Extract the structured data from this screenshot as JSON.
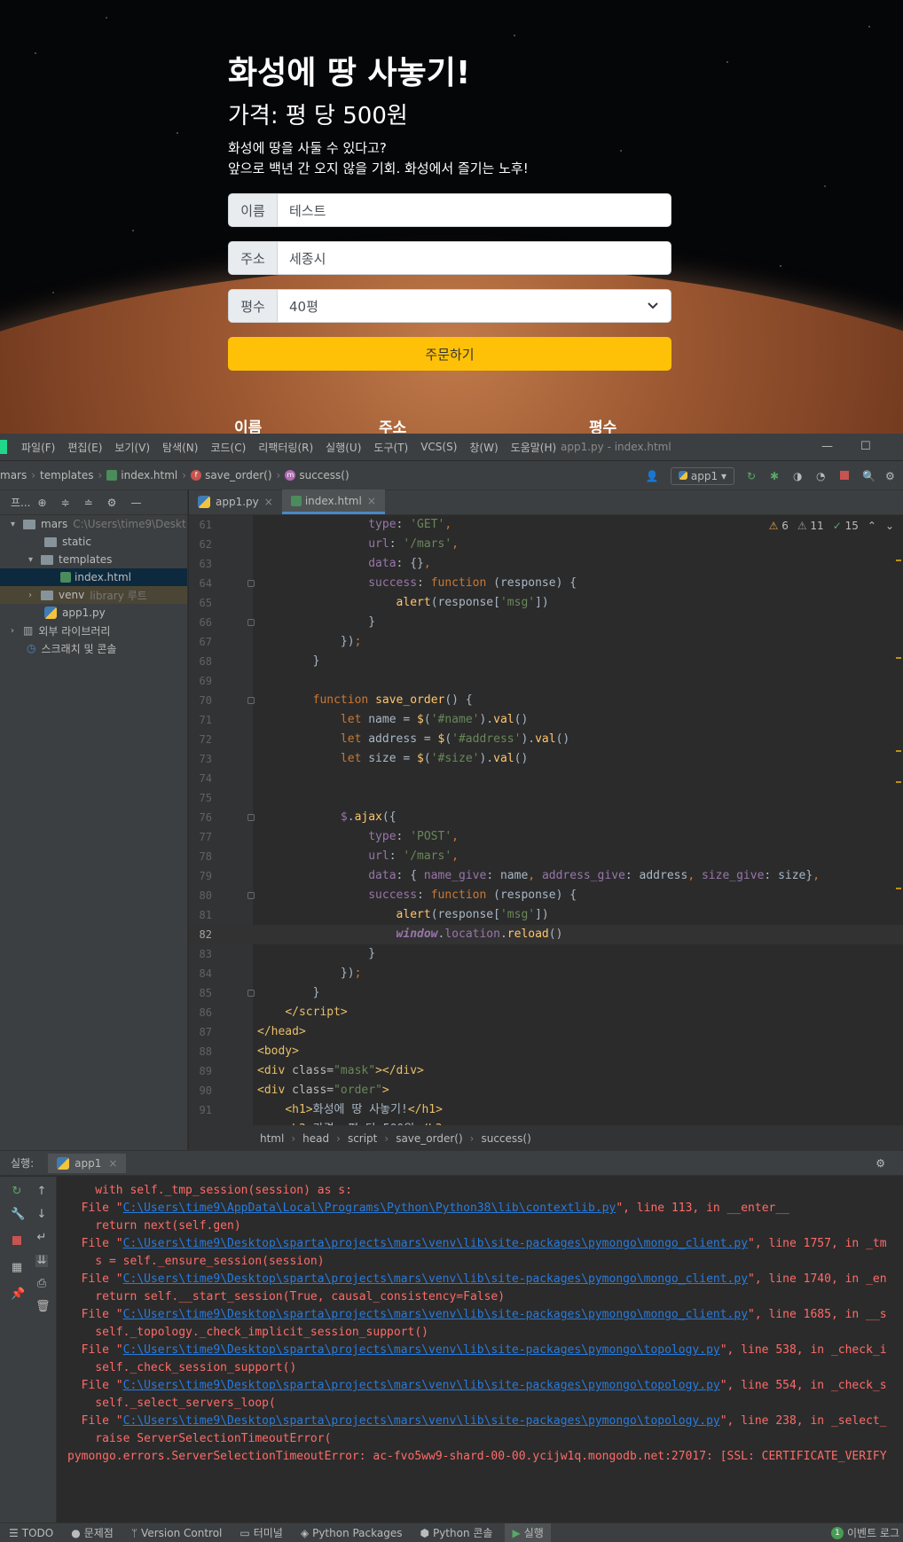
{
  "webpage": {
    "title": "화성에 땅 사놓기!",
    "price": "가격: 평 당 500원",
    "desc_line1": "화성에 땅을 사둘 수 있다고?",
    "desc_line2": "앞으로 백년 간 오지 않을 기회. 화성에서 즐기는 노후!",
    "fields": [
      {
        "label": "이름",
        "value": "테스트"
      },
      {
        "label": "주소",
        "value": "세종시"
      },
      {
        "label": "평수",
        "value": "40평"
      }
    ],
    "order_button": "주문하기",
    "table_headers": [
      "이름",
      "주소",
      "평수"
    ]
  },
  "ide": {
    "menu": [
      "파일(F)",
      "편집(E)",
      "보기(V)",
      "탐색(N)",
      "코드(C)",
      "리팩터링(R)",
      "실행(U)",
      "도구(T)",
      "VCS(S)",
      "창(W)",
      "도움말(H)"
    ],
    "window_title": "app1.py - index.html",
    "breadcrumbs": [
      "mars",
      "templates",
      "index.html",
      "save_order()",
      "success()"
    ],
    "run_config": "app1",
    "project_panel_title": "프...",
    "tree": [
      {
        "label": "mars",
        "extra": "C:\\Users\\time9\\Deskt"
      },
      {
        "label": "static"
      },
      {
        "label": "templates"
      },
      {
        "label": "index.html"
      },
      {
        "label": "venv",
        "extra": "library 루트"
      },
      {
        "label": "app1.py"
      },
      {
        "label": "외부 라이브러리"
      },
      {
        "label": "스크래치 및 콘솔"
      }
    ],
    "tabs": [
      "app1.py",
      "index.html"
    ],
    "inspections": {
      "warn": "6",
      "weak": "11",
      "ok": "15"
    },
    "code_crumbs": [
      "html",
      "head",
      "script",
      "save_order()",
      "success()"
    ],
    "run_label": "실행:",
    "run_tab": "app1",
    "console_lines": [
      {
        "pre": "    with self._tmp_session(session) as s:"
      },
      {
        "pre": "  File \"",
        "link": "C:\\Users\\time9\\AppData\\Local\\Programs\\Python\\Python38\\lib\\contextlib.py",
        "post": "\", line 113, in __enter__"
      },
      {
        "pre": "    return next(self.gen)"
      },
      {
        "pre": "  File \"",
        "link": "C:\\Users\\time9\\Desktop\\sparta\\projects\\mars\\venv\\lib\\site-packages\\pymongo\\mongo_client.py",
        "post": "\", line 1757, in _tm"
      },
      {
        "pre": "    s = self._ensure_session(session)"
      },
      {
        "pre": "  File \"",
        "link": "C:\\Users\\time9\\Desktop\\sparta\\projects\\mars\\venv\\lib\\site-packages\\pymongo\\mongo_client.py",
        "post": "\", line 1740, in _en"
      },
      {
        "pre": "    return self.__start_session(True, causal_consistency=False)"
      },
      {
        "pre": "  File \"",
        "link": "C:\\Users\\time9\\Desktop\\sparta\\projects\\mars\\venv\\lib\\site-packages\\pymongo\\mongo_client.py",
        "post": "\", line 1685, in __s"
      },
      {
        "pre": "    self._topology._check_implicit_session_support()"
      },
      {
        "pre": "  File \"",
        "link": "C:\\Users\\time9\\Desktop\\sparta\\projects\\mars\\venv\\lib\\site-packages\\pymongo\\topology.py",
        "post": "\", line 538, in _check_i"
      },
      {
        "pre": "    self._check_session_support()"
      },
      {
        "pre": "  File \"",
        "link": "C:\\Users\\time9\\Desktop\\sparta\\projects\\mars\\venv\\lib\\site-packages\\pymongo\\topology.py",
        "post": "\", line 554, in _check_s"
      },
      {
        "pre": "    self._select_servers_loop("
      },
      {
        "pre": "  File \"",
        "link": "C:\\Users\\time9\\Desktop\\sparta\\projects\\mars\\venv\\lib\\site-packages\\pymongo\\topology.py",
        "post": "\", line 238, in _select_"
      },
      {
        "pre": "    raise ServerSelectionTimeoutError("
      },
      {
        "pre": "pymongo.errors.ServerSelectionTimeoutError: ac-fvo5ww9-shard-00-00.ycijw1q.mongodb.net:27017: [SSL: CERTIFICATE_VERIFY"
      }
    ],
    "status_items": [
      "TODO",
      "문제점",
      "Version Control",
      "터미널",
      "Python Packages",
      "Python 콘솔",
      "실행"
    ],
    "event_log": "이벤트 로그",
    "event_count": "1"
  }
}
